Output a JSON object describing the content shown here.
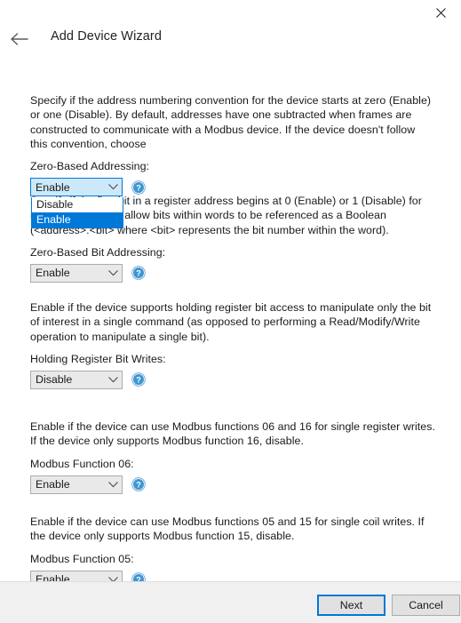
{
  "window": {
    "title": "Add Device Wizard",
    "close_icon": "close-icon",
    "back_icon": "back-arrow-icon"
  },
  "sections": [
    {
      "id": "zero-based-addressing",
      "description": "Specify if the address numbering convention for the device starts at zero (Enable) or one (Disable). By default, addresses have one subtracted when frames are constructed to communicate with a Modbus device. If the device doesn't follow this convention, choose",
      "label": "Zero-Based Addressing:",
      "value": "Enable",
      "options": [
        "Disable",
        "Enable"
      ],
      "open": true,
      "help_icon": "help-icon"
    },
    {
      "id": "zero-based-bit-addressing",
      "description": "Specify if the first bit in a register address begins at 0 (Enable) or 1 (Disable) for memory types that allow bits within words to be referenced as a Boolean (<address>.<bit> where <bit> represents the bit number within the word).",
      "label": "Zero-Based Bit Addressing:",
      "value": "Enable",
      "options": [
        "Disable",
        "Enable"
      ],
      "open": false,
      "help_icon": "help-icon"
    },
    {
      "id": "holding-register-bit-writes",
      "description": "Enable if the device supports holding register bit access to manipulate only the bit of interest in a single command (as opposed to performing a Read/Modify/Write operation to manipulate a single bit).",
      "label": "Holding Register Bit Writes:",
      "value": "Disable",
      "options": [
        "Disable",
        "Enable"
      ],
      "open": false,
      "help_icon": "help-icon"
    },
    {
      "id": "modbus-function-06",
      "description": "Enable if the device can use Modbus functions 06 and 16 for single register writes. If the device only supports Modbus function 16, disable.",
      "label": "Modbus Function 06:",
      "value": "Enable",
      "options": [
        "Disable",
        "Enable"
      ],
      "open": false,
      "help_icon": "help-icon"
    },
    {
      "id": "modbus-function-05",
      "description": "Enable if the device can use Modbus functions 05 and 15 for single coil writes. If the device only supports Modbus function 15, disable.",
      "label": "Modbus Function 05:",
      "value": "Enable",
      "options": [
        "Disable",
        "Enable"
      ],
      "open": false,
      "help_icon": "help-icon"
    }
  ],
  "footer": {
    "next_label": "Next",
    "cancel_label": "Cancel"
  },
  "colors": {
    "accent": "#0078d7",
    "footer_bg": "#f0f0f0",
    "combo_bg": "#e9e9e9",
    "combo_border": "#acacac",
    "highlight": "#0078d7"
  }
}
